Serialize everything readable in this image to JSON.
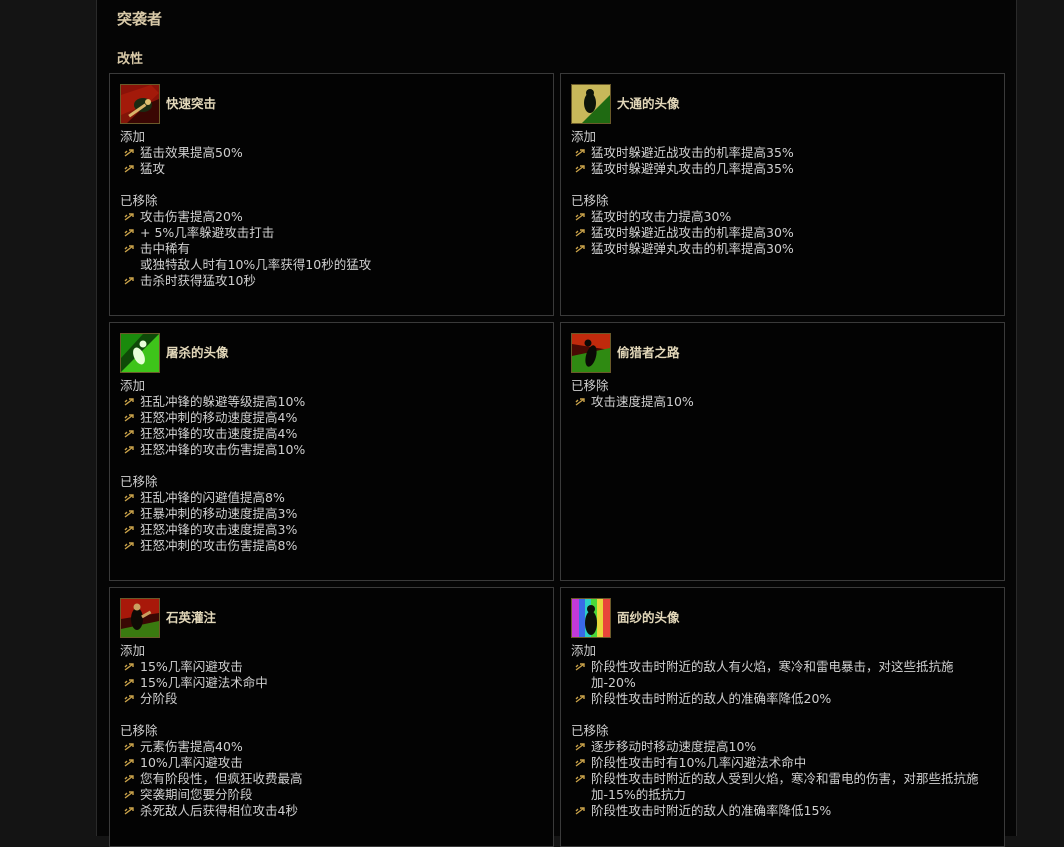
{
  "title": "突袭者",
  "section": "改性",
  "colors": {
    "label": "#d8c9a8",
    "text": "#cfcfcf",
    "border": "#3a3a3a",
    "bullet": "#c9a24a"
  },
  "cards": [
    {
      "name": "快速突击",
      "icon": "red-charge-portrait-icon",
      "groups": [
        {
          "label": "添加",
          "items": [
            "猛击效果提高50%",
            "猛攻"
          ]
        },
        {
          "label": "已移除",
          "items": [
            "攻击伤害提高20%",
            "+ 5%几率躲避攻击打击",
            "击中稀有\n或独特敌人时有10%几率获得10秒的猛攻",
            "击杀时获得猛攻10秒"
          ]
        }
      ]
    },
    {
      "name": "大通的头像",
      "icon": "green-gold-avatar-icon",
      "groups": [
        {
          "label": "添加",
          "items": [
            "猛攻时躲避近战攻击的机率提高35%",
            "猛攻时躲避弹丸攻击的几率提高35%"
          ]
        },
        {
          "label": "已移除",
          "items": [
            "猛攻时的攻击力提高30%",
            "猛攻时躲避近战攻击的机率提高30%",
            "猛攻时躲避弹丸攻击的机率提高30%"
          ]
        }
      ]
    },
    {
      "name": "屠杀的头像",
      "icon": "green-slaughter-avatar-icon",
      "groups": [
        {
          "label": "添加",
          "items": [
            "狂乱冲锋的躲避等级提高10%",
            "狂怒冲刺的移动速度提高4%",
            "狂怒冲锋的攻击速度提高4%",
            "狂怒冲锋的攻击伤害提高10%"
          ]
        },
        {
          "label": "已移除",
          "items": [
            "狂乱冲锋的闪避值提高8%",
            "狂暴冲刺的移动速度提高3%",
            "狂怒冲锋的攻击速度提高3%",
            "狂怒冲刺的攻击伤害提高8%"
          ]
        }
      ]
    },
    {
      "name": "偷猎者之路",
      "icon": "poacher-path-icon",
      "groups": [
        {
          "label": "已移除",
          "items": [
            "攻击速度提高10%"
          ]
        }
      ]
    },
    {
      "name": "石英灌注",
      "icon": "quartz-infusion-icon",
      "groups": [
        {
          "label": "添加",
          "items": [
            "15%几率闪避攻击",
            "15%几率闪避法术命中",
            "分阶段"
          ]
        },
        {
          "label": "已移除",
          "items": [
            "元素伤害提高40%",
            "10%几率闪避攻击",
            "您有阶段性，但疯狂收费最高",
            "突袭期间您要分阶段",
            "杀死敌人后获得相位攻击4秒"
          ]
        }
      ]
    },
    {
      "name": "面纱的头像",
      "icon": "rainbow-veil-avatar-icon",
      "groups": [
        {
          "label": "添加",
          "items": [
            "阶段性攻击时附近的敌人有火焰，寒冷和雷电暴击，对这些抵抗施\n加-20%",
            "阶段性攻击时附近的敌人的准确率降低20%"
          ]
        },
        {
          "label": "已移除",
          "items": [
            "逐步移动时移动速度提高10%",
            "阶段性攻击时有10%几率闪避法术命中",
            "阶段性攻击时附近的敌人受到火焰，寒冷和雷电的伤害，对那些抵抗施\n加-15%的抵抗力",
            "阶段性攻击时附近的敌人的准确率降低15%"
          ]
        }
      ]
    }
  ]
}
